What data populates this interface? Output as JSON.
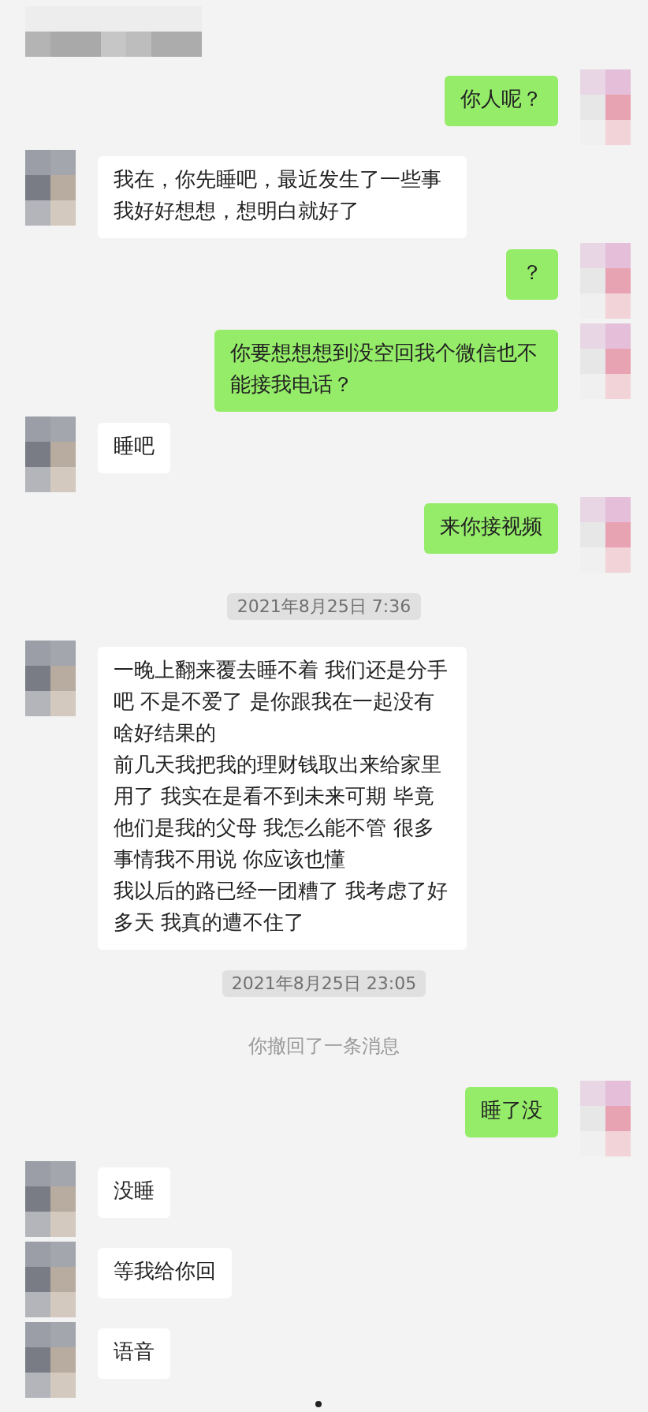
{
  "messages": [
    {
      "kind": "out",
      "text": "你人呢？"
    },
    {
      "kind": "in",
      "text": "我在，你先睡吧，最近发生了一些事我好好想想，想明白就好了"
    },
    {
      "kind": "out",
      "text": "？"
    },
    {
      "kind": "out",
      "text": "你要想想想到没空回我个微信也不能接我电话？"
    },
    {
      "kind": "in",
      "text": "睡吧"
    },
    {
      "kind": "out",
      "text": "来你接视频"
    },
    {
      "kind": "time",
      "text": "2021年8月25日 7:36"
    },
    {
      "kind": "in",
      "paragraphs": [
        "一晚上翻来覆去睡不着 我们还是分手吧 不是不爱了 是你跟我在一起没有啥好结果的",
        "前几天我把我的理财钱取出来给家里用了 我实在是看不到未来可期 毕竟他们是我的父母 我怎么能不管 很多事情我不用说 你应该也懂",
        "我以后的路已经一团糟了 我考虑了好多天 我真的遭不住了"
      ]
    },
    {
      "kind": "time",
      "text": "2021年8月25日 23:05"
    },
    {
      "kind": "system",
      "text": "你撤回了一条消息"
    },
    {
      "kind": "out",
      "text": "睡了没"
    },
    {
      "kind": "in",
      "text": "没睡"
    },
    {
      "kind": "in",
      "text": "等我给你回"
    },
    {
      "kind": "in",
      "text": "语音"
    }
  ]
}
